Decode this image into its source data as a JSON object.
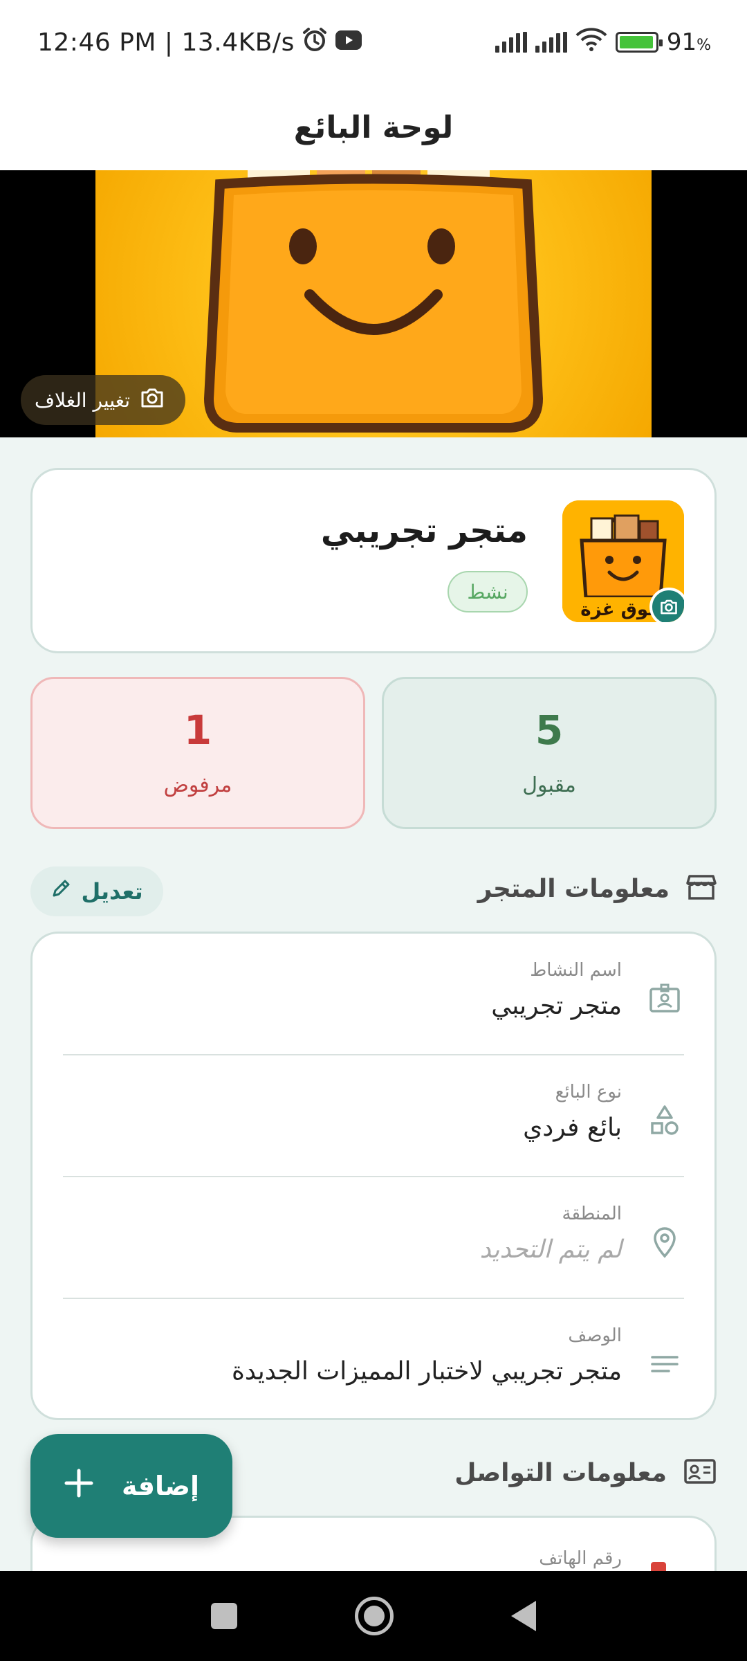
{
  "status_bar": {
    "time": "12:46 PM | 13.4KB/s",
    "battery_percent": "91",
    "battery_suffix": "%"
  },
  "header": {
    "title": "لوحة البائع"
  },
  "cover": {
    "change_cover_label": "تغيير الغلاف"
  },
  "store": {
    "name": "متجر تجريبي",
    "status": "نشط",
    "logo_text": "سوق غزة"
  },
  "stats": {
    "accepted": {
      "count": "5",
      "label": "مقبول"
    },
    "rejected": {
      "count": "1",
      "label": "مرفوض"
    }
  },
  "store_info": {
    "title": "معلومات المتجر",
    "edit_label": "تعديل",
    "fields": [
      {
        "label": "اسم النشاط",
        "value": "متجر تجريبي",
        "icon": "id-card-icon"
      },
      {
        "label": "نوع البائع",
        "value": "بائع فردي",
        "icon": "shapes-icon"
      },
      {
        "label": "المنطقة",
        "value": "لم يتم التحديد",
        "icon": "location-pin-icon"
      },
      {
        "label": "الوصف",
        "value": "متجر تجريبي لاختبار المميزات الجديدة",
        "icon": "notes-icon"
      }
    ]
  },
  "contact_info": {
    "title": "معلومات التواصل",
    "phone_label": "رقم الهاتف"
  },
  "fab": {
    "label": "إضافة"
  },
  "colors": {
    "primary": "#1f7f75",
    "accepted_bg": "#e4efeb",
    "rejected_bg": "#fbecec",
    "status_active": "#57a762"
  }
}
